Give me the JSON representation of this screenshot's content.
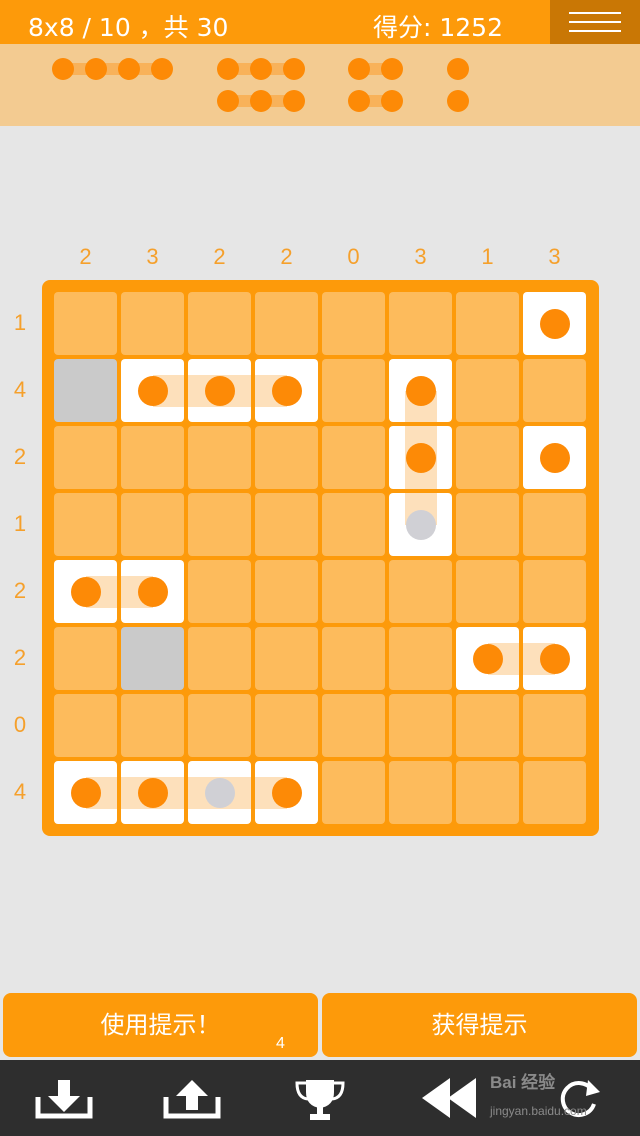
{
  "header": {
    "level": "8x8 / 10 ，共 30",
    "score": "得分: 1252",
    "menu_icon": "hamburger-icon"
  },
  "ships_panel": {
    "ships": [
      {
        "length": 4
      },
      {
        "length": 3
      },
      {
        "length": 2
      },
      {
        "length": 1
      },
      {
        "length": 3
      },
      {
        "length": 2
      },
      {
        "length": 1
      }
    ]
  },
  "board": {
    "size": 8,
    "column_counts": [
      "2",
      "3",
      "2",
      "2",
      "0",
      "3",
      "1",
      "3"
    ],
    "row_counts": [
      "1",
      "4",
      "2",
      "1",
      "2",
      "2",
      "0",
      "4"
    ],
    "cells": [
      {
        "row": 0,
        "col": 7,
        "state": "ship",
        "dot": "orange",
        "join": "none"
      },
      {
        "row": 1,
        "col": 0,
        "state": "blocked"
      },
      {
        "row": 1,
        "col": 1,
        "state": "ship",
        "dot": "orange",
        "join": "right"
      },
      {
        "row": 1,
        "col": 2,
        "state": "ship",
        "dot": "orange",
        "join": "both-h"
      },
      {
        "row": 1,
        "col": 3,
        "state": "ship",
        "dot": "orange",
        "join": "left"
      },
      {
        "row": 1,
        "col": 5,
        "state": "ship",
        "dot": "orange",
        "join": "down"
      },
      {
        "row": 2,
        "col": 5,
        "state": "ship",
        "dot": "orange",
        "join": "both-v"
      },
      {
        "row": 2,
        "col": 7,
        "state": "ship",
        "dot": "orange",
        "join": "none"
      },
      {
        "row": 3,
        "col": 5,
        "state": "ship",
        "dot": "grey",
        "join": "up"
      },
      {
        "row": 4,
        "col": 0,
        "state": "ship",
        "dot": "orange",
        "join": "right"
      },
      {
        "row": 4,
        "col": 1,
        "state": "ship",
        "dot": "orange",
        "join": "left"
      },
      {
        "row": 5,
        "col": 1,
        "state": "blocked"
      },
      {
        "row": 5,
        "col": 6,
        "state": "ship",
        "dot": "orange",
        "join": "right"
      },
      {
        "row": 5,
        "col": 7,
        "state": "ship",
        "dot": "orange",
        "join": "left"
      },
      {
        "row": 7,
        "col": 0,
        "state": "ship",
        "dot": "orange",
        "join": "right"
      },
      {
        "row": 7,
        "col": 1,
        "state": "ship",
        "dot": "orange",
        "join": "both-h"
      },
      {
        "row": 7,
        "col": 2,
        "state": "ship",
        "dot": "grey",
        "join": "both-h"
      },
      {
        "row": 7,
        "col": 3,
        "state": "ship",
        "dot": "orange",
        "join": "left"
      }
    ]
  },
  "actions": {
    "use_hint": "使用提示！",
    "hint_count": "4",
    "get_hint": "获得提示"
  },
  "toolbar": {
    "tools": [
      "download-icon",
      "upload-icon",
      "trophy-icon",
      "rewind-icon",
      "replay-icon"
    ]
  },
  "watermark": {
    "text": "Bai 经验",
    "sub": "jingyan.baidu.com"
  },
  "colors": {
    "accent": "#fd9a0a",
    "cell": "#fdbb5c",
    "dot": "#fd8a06",
    "panel": "#f3cb91",
    "toolbar": "#2e2e2e"
  }
}
